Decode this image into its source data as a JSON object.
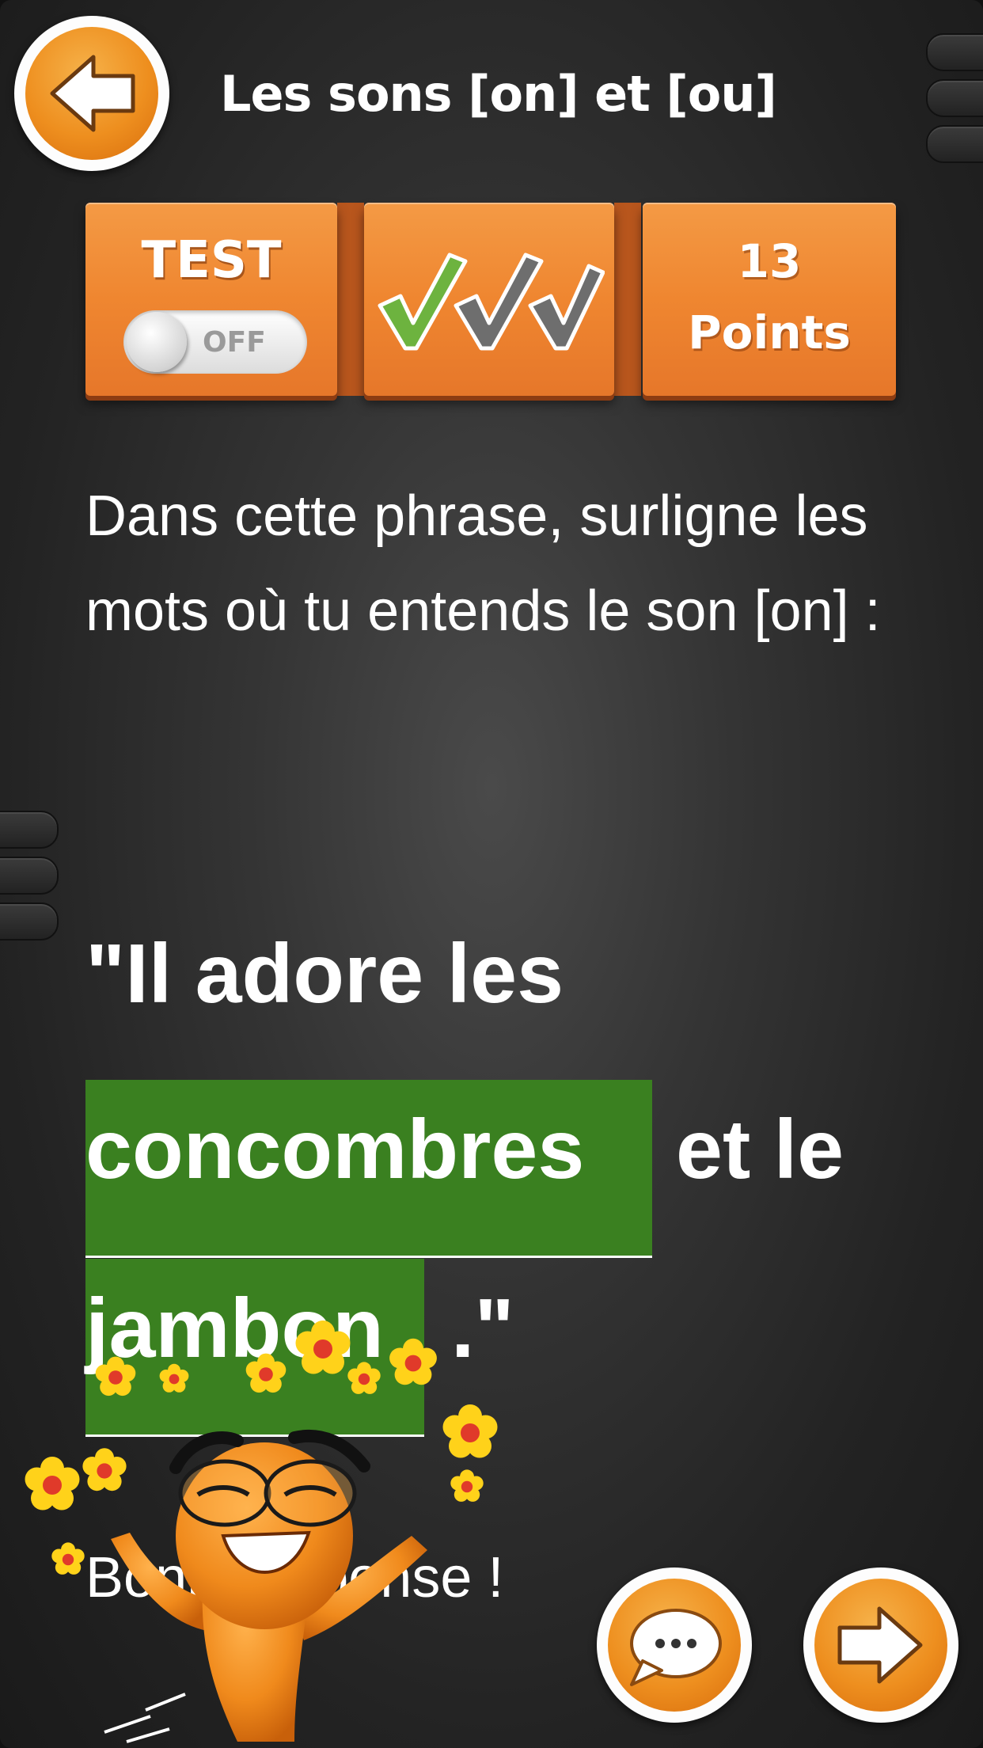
{
  "header": {
    "title": "Les sons [on] et [ou]",
    "back_icon": "arrow-left-icon"
  },
  "toolbar": {
    "test_label": "TEST",
    "toggle_state": "OFF",
    "checks": {
      "total": 3,
      "correct": 1,
      "correct_color": "#6db33f",
      "pending_color": "#6e6e6e"
    },
    "points_value": "13",
    "points_label": "Points",
    "accent_color": "#ef8630"
  },
  "exercise": {
    "instruction": "Dans cette phrase, surligne les mots où tu entends le son [on] :",
    "sentence_line1": "\"Il adore les",
    "word_highlight_1": "concombres",
    "word_plain_1": "et le",
    "word_highlight_2": "jambon",
    "word_end": ".\"",
    "highlight_color": "#3a8020"
  },
  "feedback": {
    "result": "Bonne réponse !"
  },
  "footer": {
    "chat_icon": "speech-bubble-icon",
    "next_icon": "arrow-right-icon"
  }
}
